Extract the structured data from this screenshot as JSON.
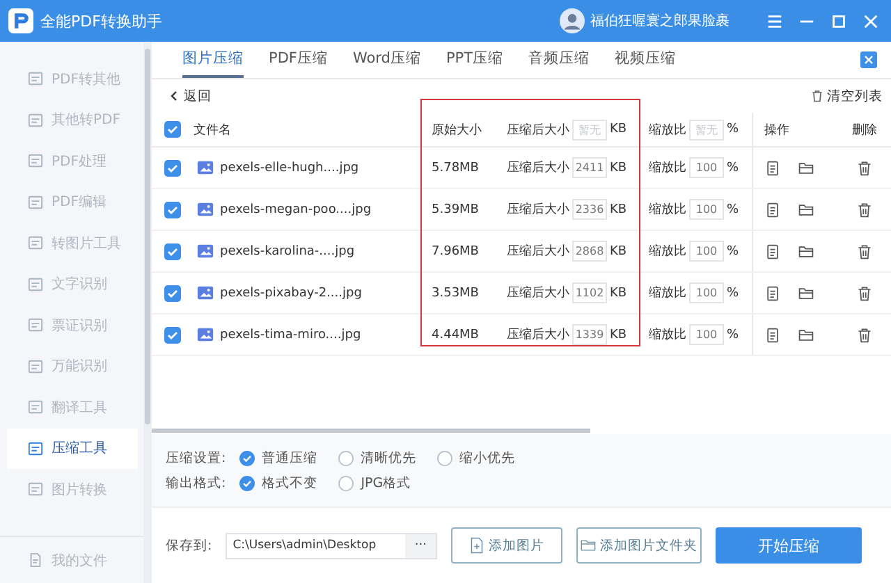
{
  "app": {
    "title": "全能PDF转换助手",
    "user": "福伯狂喔寰之郎果脸裹"
  },
  "sidebar": {
    "items": [
      {
        "label": "PDF转其他",
        "selected": false
      },
      {
        "label": "其他转PDF",
        "selected": false
      },
      {
        "label": "PDF处理",
        "selected": false
      },
      {
        "label": "PDF编辑",
        "selected": false
      },
      {
        "label": "转图片工具",
        "selected": false
      },
      {
        "label": "文字识别",
        "selected": false
      },
      {
        "label": "票证识别",
        "selected": false
      },
      {
        "label": "万能识别",
        "selected": false
      },
      {
        "label": "翻译工具",
        "selected": false
      },
      {
        "label": "压缩工具",
        "selected": true
      },
      {
        "label": "图片转换",
        "selected": false
      }
    ],
    "footer": "我的文件"
  },
  "tabs": [
    {
      "label": "图片压缩",
      "selected": true
    },
    {
      "label": "PDF压缩",
      "selected": false
    },
    {
      "label": "Word压缩",
      "selected": false
    },
    {
      "label": "PPT压缩",
      "selected": false
    },
    {
      "label": "音频压缩",
      "selected": false
    },
    {
      "label": "视频压缩",
      "selected": false
    }
  ],
  "back": "返回",
  "clear": "清空列表",
  "table": {
    "select_all": true,
    "header": {
      "name": "文件名",
      "original": "原始大小",
      "compressed_label": "压缩后大小",
      "compressed_placeholder": "暂无",
      "compressed_unit": "KB",
      "scale_label": "缩放比",
      "scale_placeholder": "暂无",
      "scale_unit": "%",
      "actions": "操作",
      "delete": "删除"
    },
    "rows": [
      {
        "checked": true,
        "name": "pexels-elle-hugh....jpg",
        "original": "5.78MB",
        "compressed_label": "压缩后大小",
        "compressed": "2411",
        "unit": "KB",
        "scale_label": "缩放比",
        "scale": "100",
        "scale_unit": "%"
      },
      {
        "checked": true,
        "name": "pexels-megan-poo....jpg",
        "original": "5.39MB",
        "compressed_label": "压缩后大小",
        "compressed": "2336",
        "unit": "KB",
        "scale_label": "缩放比",
        "scale": "100",
        "scale_unit": "%"
      },
      {
        "checked": true,
        "name": "pexels-karolina-....jpg",
        "original": "7.96MB",
        "compressed_label": "压缩后大小",
        "compressed": "2868",
        "unit": "KB",
        "scale_label": "缩放比",
        "scale": "100",
        "scale_unit": "%"
      },
      {
        "checked": true,
        "name": "pexels-pixabay-2....jpg",
        "original": "3.53MB",
        "compressed_label": "压缩后大小",
        "compressed": "1102",
        "unit": "KB",
        "scale_label": "缩放比",
        "scale": "100",
        "scale_unit": "%"
      },
      {
        "checked": true,
        "name": "pexels-tima-miro....jpg",
        "original": "4.44MB",
        "compressed_label": "压缩后大小",
        "compressed": "1339",
        "unit": "KB",
        "scale_label": "缩放比",
        "scale": "100",
        "scale_unit": "%"
      }
    ]
  },
  "highlight": {
    "color": "#d9363e"
  },
  "settings": [
    {
      "label": "压缩设置:",
      "options": [
        {
          "label": "普通压缩",
          "selected": true
        },
        {
          "label": "清晰优先",
          "selected": false
        },
        {
          "label": "缩小优先",
          "selected": false
        }
      ]
    },
    {
      "label": "输出格式:",
      "options": [
        {
          "label": "格式不变",
          "selected": true
        },
        {
          "label": "JPG格式",
          "selected": false
        }
      ]
    }
  ],
  "save": {
    "label": "保存到:",
    "path": "C:\\Users\\admin\\Desktop",
    "browse": "···"
  },
  "buttons": [
    {
      "kind": "outline",
      "label": "添加图片"
    },
    {
      "kind": "outline",
      "label": "添加图片文件夹"
    },
    {
      "kind": "primary",
      "label": "开始压缩"
    }
  ]
}
